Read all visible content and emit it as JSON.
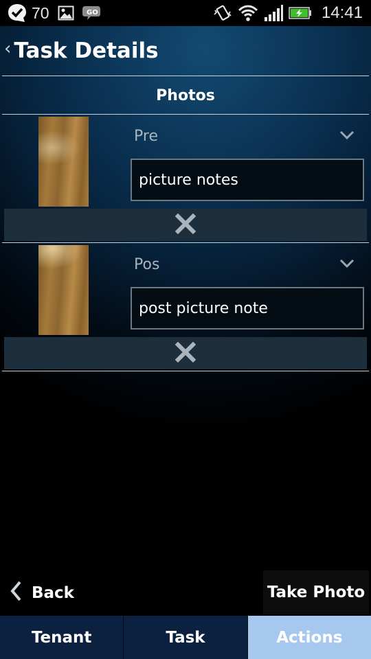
{
  "status_bar": {
    "battery_notification_count": "70",
    "time": "14:41",
    "icons": [
      "check-bubble-icon",
      "image-icon",
      "go-chat-icon",
      "vibrate-icon",
      "wifi-icon",
      "signal-icon",
      "battery-charging-icon"
    ]
  },
  "header": {
    "title": "Task Details"
  },
  "photos_section": {
    "title": "Photos",
    "items": [
      {
        "type_value": "Pre",
        "note_value": "picture notes"
      },
      {
        "type_value": "Pos",
        "note_value": "post picture note"
      }
    ]
  },
  "actions": {
    "back_label": "Back",
    "take_photo_label": "Take Photo"
  },
  "tabs": [
    {
      "label": "Tenant",
      "active": false
    },
    {
      "label": "Task",
      "active": false
    },
    {
      "label": "Actions",
      "active": true
    }
  ],
  "colors": {
    "active_tab": "#a7c8ee",
    "tab_background": "#0c2140",
    "delete_bar": "#1d2e3c"
  }
}
